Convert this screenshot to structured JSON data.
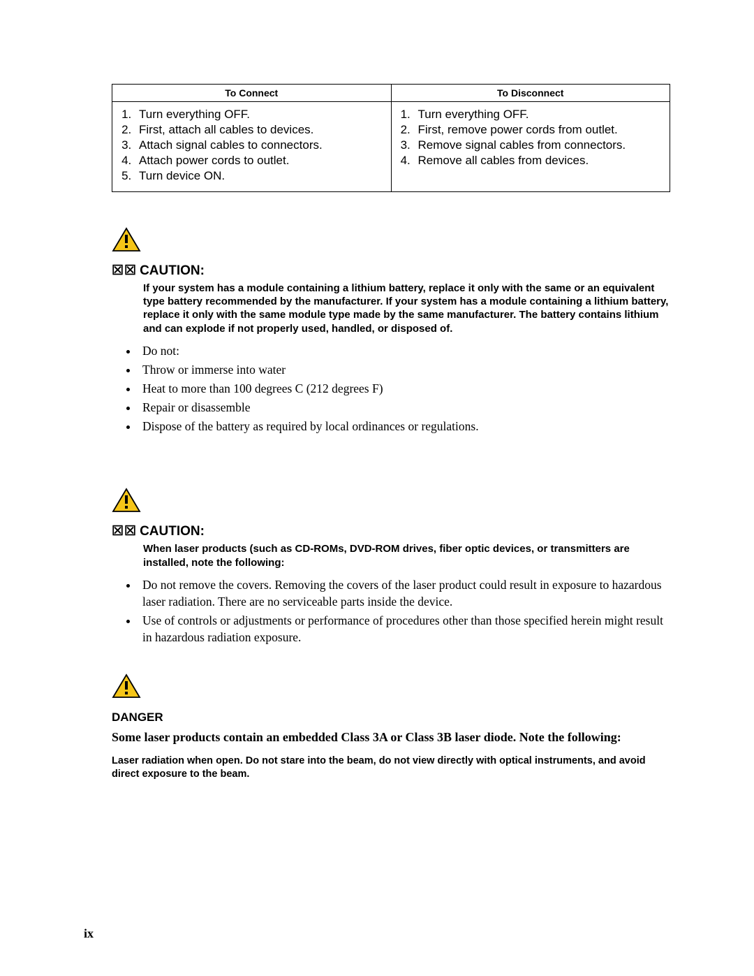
{
  "table": {
    "headers": {
      "connect": "To Connect",
      "disconnect": "To Disconnect"
    },
    "connect": [
      "Turn everything OFF.",
      "First, attach all cables to devices.",
      "Attach signal cables to connectors.",
      "Attach power cords to outlet.",
      "Turn device ON."
    ],
    "disconnect": [
      "Turn everything OFF.",
      "First, remove power cords from outlet.",
      "Remove signal cables from connectors.",
      "Remove all cables from devices."
    ]
  },
  "caution1": {
    "label": "CAUTION:",
    "boxes": "☒☒",
    "bold_text": "If your system has a module containing a lithium battery, replace it only with the same or an equivalent type battery recommended by the manufacturer. If your system has a module containing a lithium battery, replace it only with the same module type made by the same manufacturer. The battery contains lithium and can explode if not properly used, handled, or disposed of.",
    "bullets": [
      "Do not:",
      "Throw or immerse into water",
      "Heat to more than 100 degrees C (212 degrees F)",
      "Repair or disassemble",
      "Dispose of the battery as required by local ordinances or regulations."
    ]
  },
  "caution2": {
    "label": "CAUTION:",
    "boxes": "☒☒",
    "bold_text": "When laser products (such as CD-ROMs, DVD-ROM drives, fiber optic devices, or transmitters are installed, note the following:",
    "bullets": [
      "Do not remove the covers. Removing the covers of the laser product could result in exposure to hazardous laser radiation. There are no serviceable parts inside the device.",
      "Use of controls or adjustments or performance of procedures other than those specified herein might result in hazardous radiation exposure."
    ]
  },
  "danger": {
    "label": "DANGER",
    "body": "Some laser products contain an embedded Class 3A or Class 3B laser diode. Note the following:",
    "small": "Laser radiation when open. Do not stare into the beam, do not view directly with optical instruments, and avoid direct exposure to the beam."
  },
  "page_number": "ix"
}
